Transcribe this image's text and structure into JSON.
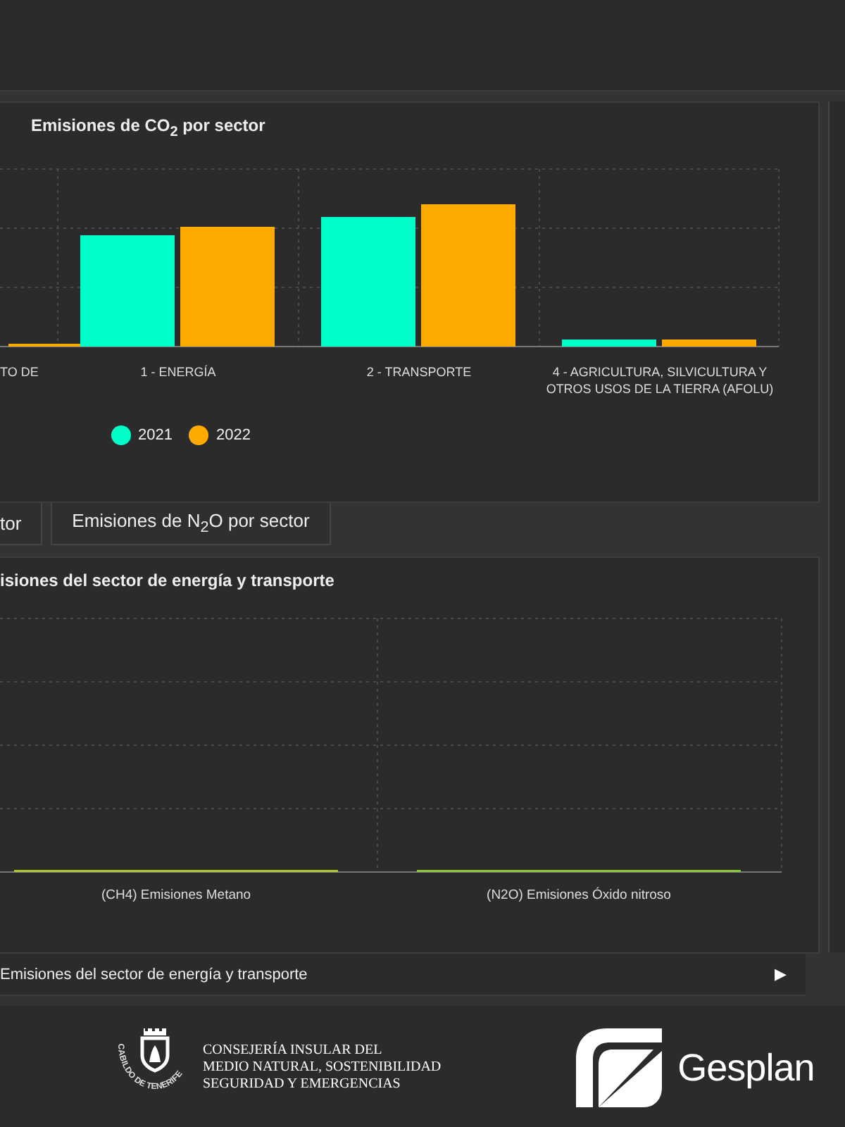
{
  "co2_card": {
    "title": "Emisiones de CO$_{2}$ por sector",
    "categories": [
      "TO DE",
      "1 - ENERGÍA",
      "2 - TRANSPORTE",
      "4 - AGRICULTURA, SILVICULTURA Y\nOTROS USOS DE LA TIERRA (AFOLU)"
    ],
    "legend": [
      {
        "label": "2021",
        "color": "#00ffc8"
      },
      {
        "label": "2022",
        "color": "#ffaa00"
      }
    ]
  },
  "tabs": [
    {
      "label": "tor",
      "selected": false
    },
    {
      "label": "Emisiones de N$_{2}$O por sector",
      "selected": false
    }
  ],
  "energy_card": {
    "title": "isiones del sector de energía y transporte",
    "categories": [
      "(CH4) Emisiones Metano",
      "(N2O) Emisiones Óxido nitroso"
    ]
  },
  "nav_bar": {
    "label": "Emisiones del sector de energía y transporte",
    "next": "▶"
  },
  "footer": {
    "crest_text": "CABILDO DE TENERIFE",
    "department": "CONSEJERÍA INSULAR DEL\nMEDIO NATURAL, SOSTENIBILIDAD\nSEGURIDAD Y EMERGENCIAS",
    "brand": "Gesplan"
  }
}
